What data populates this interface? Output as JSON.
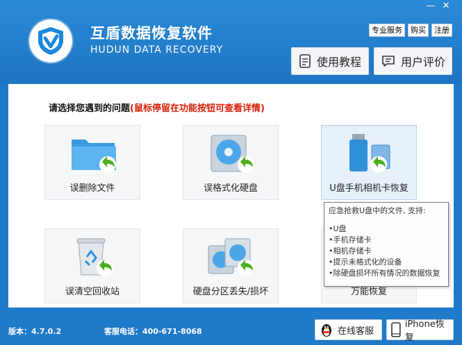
{
  "window": {
    "minimize_glyph": "—",
    "close_glyph": "✕"
  },
  "app": {
    "title": "互盾数据恢复软件",
    "subtitle": "HUDUN DATA RECOVERY"
  },
  "top_links": [
    "专业服务",
    "购买",
    "注册"
  ],
  "header_buttons": {
    "tutorial": "使用教程",
    "review": "用户评价"
  },
  "main": {
    "prompt": "请选择您遇到的问题",
    "prompt_hint": "(鼠标停留在功能按钮可查看详情)",
    "tiles": [
      {
        "label": "误删除文件",
        "icon": "folder-restore-icon"
      },
      {
        "label": "误格式化硬盘",
        "icon": "hard-disk-restore-icon"
      },
      {
        "label": "U盘手机相机卡恢复",
        "icon": "usb-card-restore-icon"
      },
      {
        "label": "误清空回收站",
        "icon": "recycle-bin-restore-icon"
      },
      {
        "label": "硬盘分区丢失/损坏",
        "icon": "partition-restore-icon"
      },
      {
        "label": "万能恢复",
        "icon": "universal-restore-icon"
      }
    ],
    "tooltip": {
      "title": "应急抢救U盘中的文件, 支持:",
      "items": [
        "•U盘",
        "•手机存储卡",
        "•相机存储卡",
        "•提示未格式化的设备",
        "•除硬盘损坏所有情况的数据恢复"
      ]
    }
  },
  "status": {
    "version": "版本：4.7.0.2",
    "phone": "客服电话：400-671-8068",
    "online_service": "在线客服",
    "iphone_recovery": "iPhone恢复"
  },
  "colors": {
    "brand_blue": "#1f7ac9",
    "hint_red": "#d81e06",
    "arrow_green": "#4caf1e"
  }
}
